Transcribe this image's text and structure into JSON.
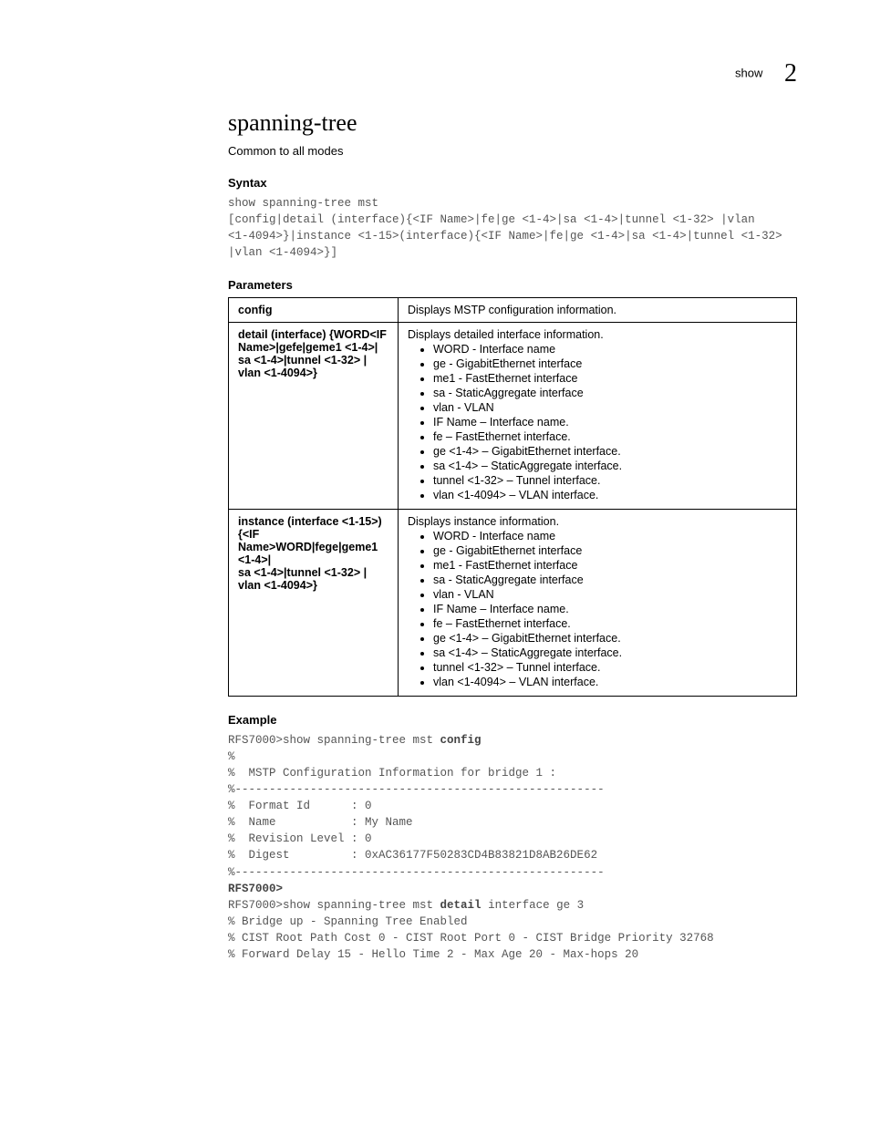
{
  "header": {
    "label": "show",
    "chapter": "2"
  },
  "title": "spanning-tree",
  "subtitle": "Common to all modes",
  "syntax_heading": "Syntax",
  "syntax_code": "show spanning-tree mst\n[config|detail (interface){<IF Name>|fe|ge <1-4>|sa <1-4>|tunnel <1-32> |vlan \n<1-4094>}|instance <1-15>(interface){<IF Name>|fe|ge <1-4>|sa <1-4>|tunnel <1-32> \n|vlan <1-4094>}]",
  "params_heading": "Parameters",
  "params": [
    {
      "name": "config",
      "desc_intro": "Displays MSTP configuration information.",
      "bullets": []
    },
    {
      "name": "detail (interface) {WORD<IF Name>|gefe|geme1 <1-4>|\nsa <1-4>|tunnel <1-32> |\nvlan <1-4094>}",
      "desc_intro": "Displays detailed interface information.",
      "bullets": [
        "WORD - Interface name",
        "ge - GigabitEthernet interface",
        "me1 - FastEthernet interface",
        "sa - StaticAggregate interface",
        "vlan - VLAN",
        "IF Name – Interface name.",
        "fe – FastEthernet interface.",
        "ge <1-4> – GigabitEthernet interface.",
        "sa <1-4> – StaticAggregate interface.",
        "tunnel <1-32> – Tunnel interface.",
        "vlan <1-4094> – VLAN interface."
      ]
    },
    {
      "name": "instance (interface <1-15>) {<IF Name>WORD|fege|geme1 <1-4>|\nsa <1-4>|tunnel <1-32> |\nvlan <1-4094>}",
      "desc_intro": "Displays instance information.",
      "bullets": [
        "WORD - Interface name",
        "ge - GigabitEthernet interface",
        "me1 - FastEthernet interface",
        "sa - StaticAggregate interface",
        "vlan - VLAN",
        "IF Name – Interface name.",
        "fe – FastEthernet interface.",
        "ge <1-4> – GigabitEthernet interface.",
        "sa <1-4> – StaticAggregate interface.",
        "tunnel <1-32> – Tunnel interface.",
        "vlan <1-4094> – VLAN interface."
      ]
    }
  ],
  "example_heading": "Example",
  "example": {
    "l1_pre": "RFS7000>show spanning-tree mst ",
    "l1_bold": "config",
    "l2": "%",
    "l3": "%  MSTP Configuration Information for bridge 1 :",
    "l4": "%------------------------------------------------------",
    "l5": "%  Format Id      : 0",
    "l6": "%  Name           : My Name",
    "l7": "%  Revision Level : 0",
    "l8": "%  Digest         : 0xAC36177F50283CD4B83821D8AB26DE62",
    "l9": "%------------------------------------------------------",
    "l10": "RFS7000>",
    "l11_pre": "RFS7000>show spanning-tree mst ",
    "l11_bold": "detail",
    "l11_post": " interface ge 3",
    "l12": "% Bridge up - Spanning Tree Enabled",
    "l13": "% CIST Root Path Cost 0 - CIST Root Port 0 - CIST Bridge Priority 32768",
    "l14": "% Forward Delay 15 - Hello Time 2 - Max Age 20 - Max-hops 20"
  }
}
